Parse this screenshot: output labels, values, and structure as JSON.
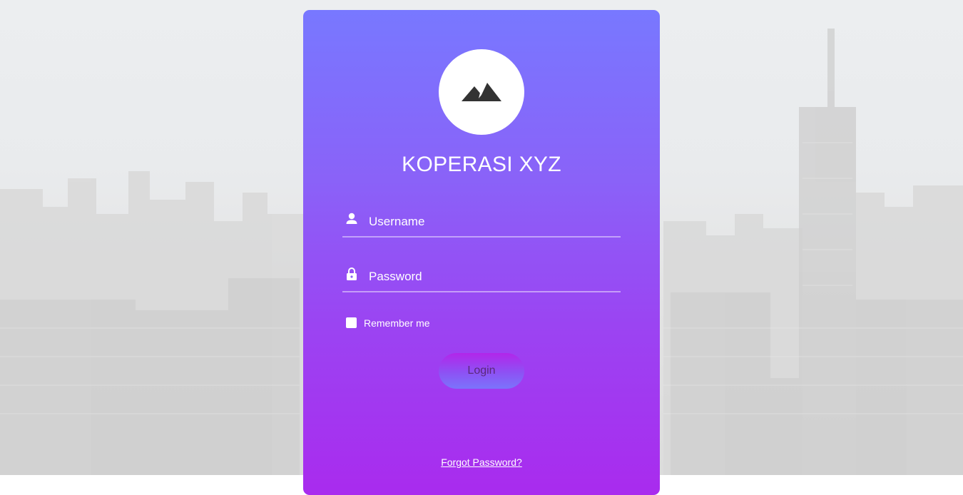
{
  "brand": {
    "title": "KOPERASI XYZ",
    "logo_icon": "mountain-icon"
  },
  "form": {
    "username": {
      "placeholder": "Username",
      "icon": "user-icon"
    },
    "password": {
      "placeholder": "Password",
      "icon": "lock-icon"
    },
    "remember_label": "Remember me",
    "login_label": "Login",
    "forgot_label": "Forgot Password?"
  },
  "colors": {
    "card_top": "#7878ff",
    "card_bottom": "#a92bee",
    "text": "#ffffff"
  }
}
